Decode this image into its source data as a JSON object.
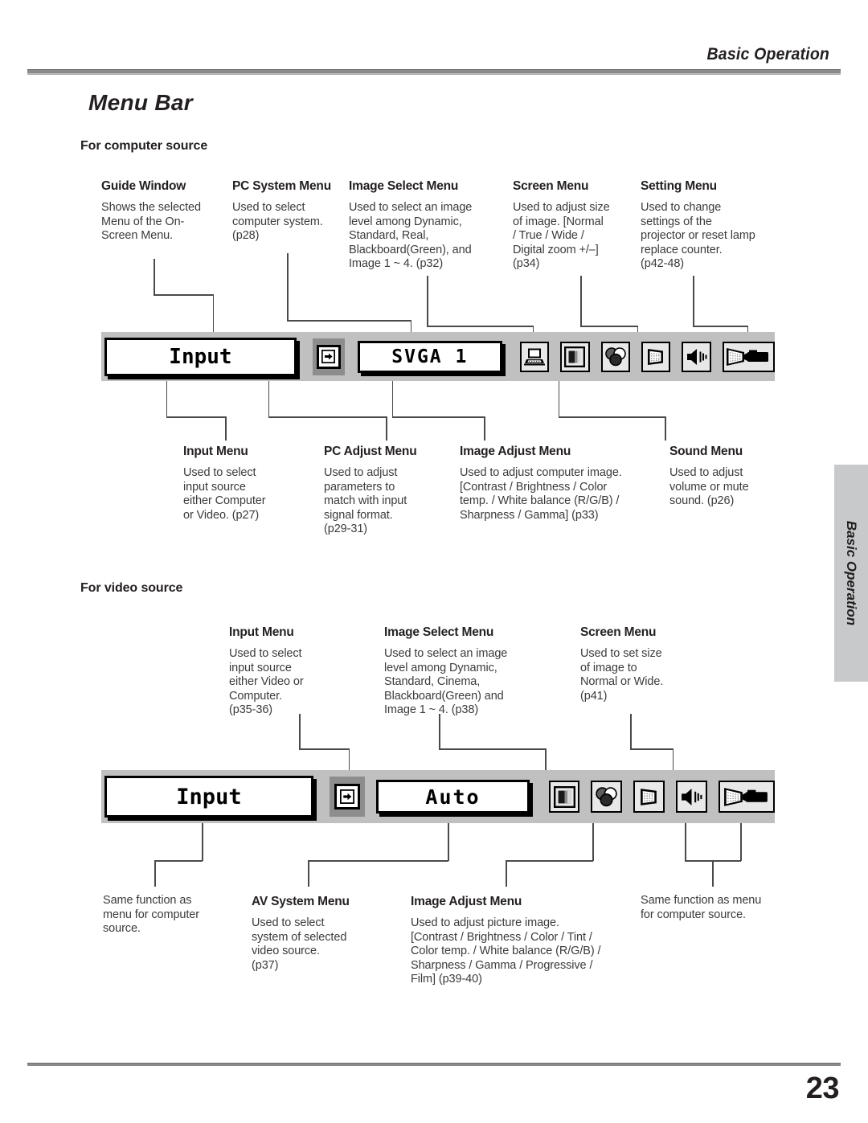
{
  "header": {
    "running_title": "Basic Operation"
  },
  "footer": {
    "page_number": "23"
  },
  "side_tab": {
    "label": "Basic Operation"
  },
  "section": {
    "title": "Menu Bar",
    "computer_subhead": "For computer source",
    "video_subhead": "For video source"
  },
  "computer": {
    "top_callouts": [
      {
        "title": "Guide Window",
        "body": "Shows the selected\nMenu of the On-\nScreen Menu."
      },
      {
        "title": "PC System Menu",
        "body": "Used to select\ncomputer system.\n(p28)"
      },
      {
        "title": "Image Select Menu",
        "body": "Used to select  an image\nlevel among Dynamic,\nStandard, Real,\nBlackboard(Green), and\nImage 1 ~ 4.  (p32)"
      },
      {
        "title": "Screen Menu",
        "body": "Used to adjust size\nof image.  [Normal\n/ True / Wide /\nDigital zoom +/–]\n(p34)"
      },
      {
        "title": "Setting Menu",
        "body": "Used to change\nsettings of the\nprojector or reset  lamp\nreplace counter.\n(p42-48)"
      }
    ],
    "bottom_callouts": [
      {
        "title": "Input Menu",
        "body": "Used to select\ninput source\neither Computer\nor Video.  (p27)"
      },
      {
        "title": "PC Adjust Menu",
        "body": "Used to adjust\nparameters to\nmatch with input\nsignal format.\n(p29-31)"
      },
      {
        "title": "Image Adjust Menu",
        "body": "Used to adjust computer image.\n[Contrast / Brightness / Color\ntemp. /  White balance (R/G/B) /\nSharpness /  Gamma]   (p33)"
      },
      {
        "title": "Sound Menu",
        "body": "Used to adjust\nvolume or mute\nsound.  (p26)"
      }
    ],
    "menu_bar": {
      "guide_label": "Input",
      "input_icon": "input-arrow-icon",
      "system_label": "SVGA 1",
      "icons": [
        "pc-adjust-monitor-icon",
        "image-select-contrast-icon",
        "image-adjust-palette-icon",
        "screen-size-icon",
        "sound-speaker-icon",
        "setting-projector-icon"
      ]
    }
  },
  "video": {
    "top_callouts": [
      {
        "title": "Input Menu",
        "body": "Used to select\ninput source\neither Video or\nComputer.\n(p35-36)"
      },
      {
        "title": "Image Select Menu",
        "body": "Used to select an image\nlevel among Dynamic,\nStandard, Cinema,\nBlackboard(Green) and\nImage 1 ~ 4.  (p38)"
      },
      {
        "title": "Screen Menu",
        "body": "Used to set size\nof image to\nNormal or Wide.\n(p41)"
      }
    ],
    "bottom_callouts": [
      {
        "title": "",
        "body": "Same function as\nmenu for computer\nsource."
      },
      {
        "title": "AV System Menu",
        "body": "Used to select\nsystem of selected\nvideo source.\n(p37)"
      },
      {
        "title": "Image Adjust Menu",
        "body": " Used to adjust picture image.\n[Contrast / Brightness / Color / Tint /\nColor temp. / White balance (R/G/B) /\nSharpness / Gamma / Progressive /\nFilm]  (p39-40)"
      },
      {
        "title": "",
        "body": "Same function as menu\nfor computer source."
      }
    ],
    "menu_bar": {
      "guide_label": "Input",
      "input_icon": "input-arrow-icon",
      "system_label": "Auto",
      "icons": [
        "image-select-contrast-icon",
        "image-adjust-palette-icon",
        "screen-size-icon",
        "sound-speaker-icon",
        "setting-projector-icon"
      ]
    }
  },
  "colors": {
    "menubar_bg": "#c0c0c0",
    "side_tab_bg": "#c8c9cb",
    "rule": "#8b8b8e",
    "text": "#231f20",
    "body_text": "#3b3b3d"
  }
}
